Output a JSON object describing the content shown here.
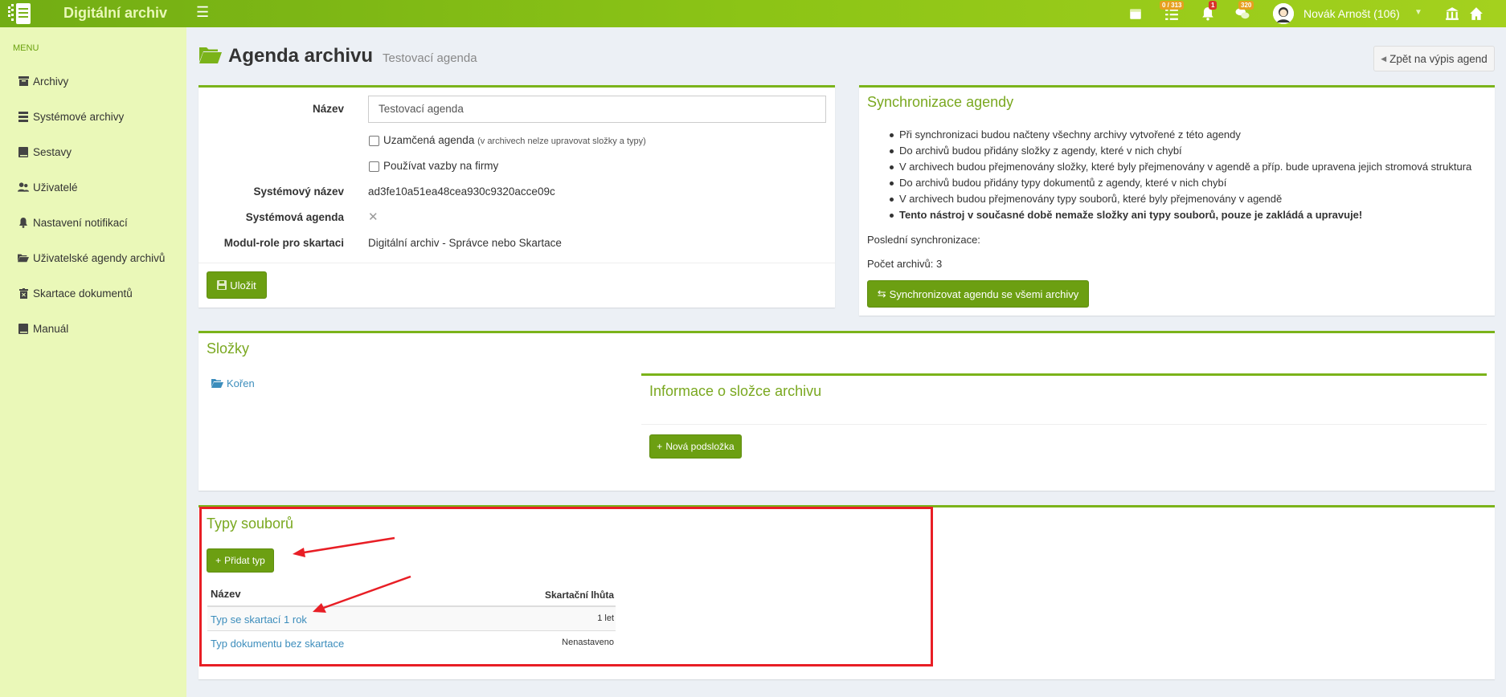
{
  "app": {
    "title": "Digitální archiv"
  },
  "topbar": {
    "badges": {
      "tasks": "0 / 313",
      "notifications": "1",
      "messages": "320"
    },
    "user_name": "Novák Arnošt (106)"
  },
  "sidebar": {
    "menu_label": "MENU",
    "items": [
      {
        "label": "Archivy",
        "icon": "archive-icon"
      },
      {
        "label": "Systémové archivy",
        "icon": "list-icon"
      },
      {
        "label": "Sestavy",
        "icon": "book-icon"
      },
      {
        "label": "Uživatelé",
        "icon": "users-icon"
      },
      {
        "label": "Nastavení notifikací",
        "icon": "bell-icon"
      },
      {
        "label": "Uživatelské agendy archivů",
        "icon": "folder-open-icon"
      },
      {
        "label": "Skartace dokumentů",
        "icon": "trash-icon"
      },
      {
        "label": "Manuál",
        "icon": "book-icon"
      }
    ]
  },
  "page": {
    "title": "Agenda archivu",
    "subtitle": "Testovací agenda",
    "back_label": "Zpět na výpis agend"
  },
  "form": {
    "name_label": "Název",
    "name_value": "Testovací agenda",
    "locked_label": "Uzamčená agenda",
    "locked_note": "(v archivech nelze upravovat složky a typy)",
    "firms_label": "Používat vazby na firmy",
    "sys_name_label": "Systémový název",
    "sys_name_value": "ad3fe10a51ea48cea930c9320acce09c",
    "sys_agenda_label": "Systémová agenda",
    "sys_agenda_value": "✕",
    "module_label": "Modul-role pro skartaci",
    "module_value": "Digitální archiv - Správce nebo Skartace",
    "save_label": "Uložit"
  },
  "sync": {
    "title": "Synchronizace agendy",
    "items": [
      "Při synchronizaci budou načteny všechny archivy vytvořené z této agendy",
      "Do archivů budou přidány složky z agendy, které v nich chybí",
      "V archivech budou přejmenovány složky, které byly přejmenovány v agendě a příp. bude upravena jejich stromová struktura",
      "Do archivů budou přidány typy dokumentů z agendy, které v nich chybí",
      "V archivech budou přejmenovány typy souborů, které byly přejmenovány v agendě"
    ],
    "warning": "Tento nástroj v současné době nemaže složky ani typy souborů, pouze je zakládá a upravuje!",
    "last_sync": "Poslední synchronizace:",
    "archive_count": "Počet archivů: 3",
    "button_label": "Synchronizovat agendu se všemi archivy"
  },
  "folders": {
    "title": "Složky",
    "root_label": "Kořen",
    "info_title": "Informace o složce archivu",
    "new_subfolder_label": "Nová podsložka"
  },
  "file_types": {
    "title": "Typy souborů",
    "add_label": "Přidat typ",
    "columns": {
      "name": "Název",
      "period": "Skartační lhůta"
    },
    "rows": [
      {
        "name": "Typ se skartací 1 rok",
        "period": "1 let"
      },
      {
        "name": "Typ dokumentu bez skartace",
        "period": "Nenastaveno"
      }
    ]
  },
  "colors": {
    "accent": "#7bb31a",
    "button": "#6c9f12",
    "annotation": "#e81e25"
  }
}
